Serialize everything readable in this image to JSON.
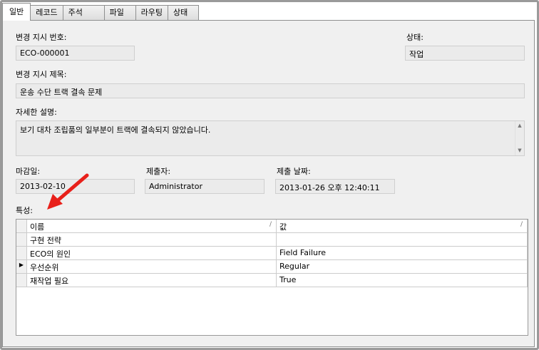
{
  "tabs": [
    "일반",
    "레코드",
    "주석",
    "파일",
    "라우팅",
    "상태"
  ],
  "fields": {
    "eco_number": {
      "label": "변경 지시 번호:",
      "value": "ECO-000001"
    },
    "status": {
      "label": "상태:",
      "value": "작업"
    },
    "title": {
      "label": "변경 지시 제목:",
      "value": "운송 수단 트랙 결속 문제"
    },
    "description": {
      "label": "자세한 설명:",
      "value": "보기 대차 조립품의 일부분이 트랙에 결속되지 않았습니다."
    },
    "due_date": {
      "label": "마감일:",
      "value": "2013-02-10"
    },
    "submitter": {
      "label": "제출자:",
      "value": "Administrator"
    },
    "submit_date": {
      "label": "제출 날짜:",
      "value": "2013-01-26 오후 12:40:11"
    }
  },
  "properties": {
    "label": "특성:",
    "columns": [
      "이름",
      "값"
    ],
    "rows": [
      {
        "name": "구현 전략",
        "value": ""
      },
      {
        "name": "ECO의 원인",
        "value": "Field Failure"
      },
      {
        "name": "우선순위",
        "value": "Regular",
        "current": true
      },
      {
        "name": "재작업 필요",
        "value": "True"
      }
    ]
  },
  "accent": "#e8201a"
}
